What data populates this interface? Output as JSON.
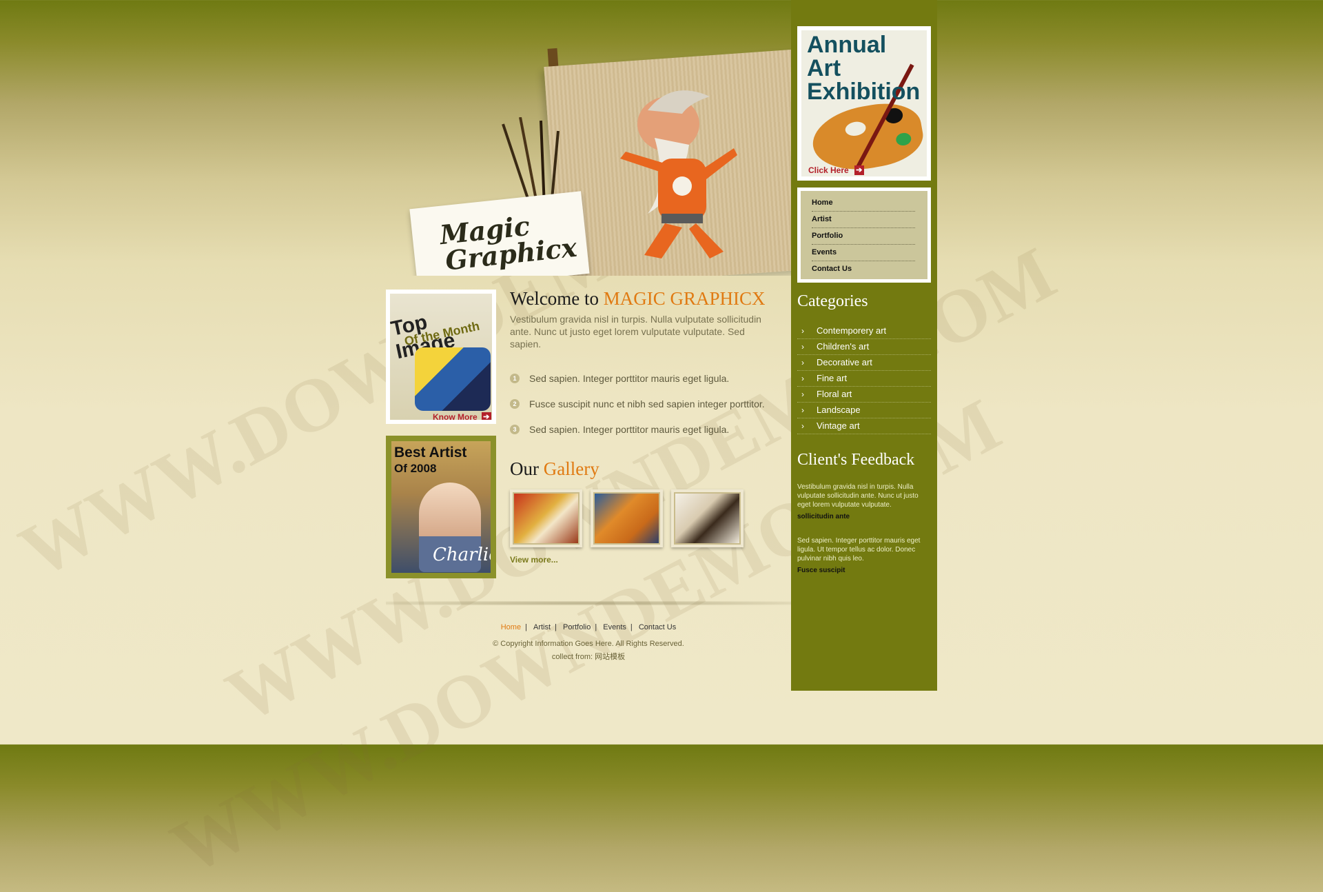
{
  "brand": {
    "logo_line1": "Magic",
    "logo_line2": "Graphicx"
  },
  "watermark": "WWW.DOWNDEMO.COM",
  "promos": {
    "top_image": {
      "title": "Top Image",
      "subtitle": "Of the Month",
      "link": "Know More"
    },
    "best_artist": {
      "title": "Best Artist",
      "subtitle": "Of 2008",
      "signature": "Charlie"
    }
  },
  "main": {
    "welcome_prefix": "Welcome to",
    "welcome_brand": "MAGIC GRAPHICX",
    "intro": "Vestibulum gravida nisl in turpis. Nulla vulputate sollicitudin ante. Nunc ut justo eget lorem vulputate vulputate. Sed sapien.",
    "list": [
      {
        "num": "1",
        "text": "Sed sapien. Integer porttitor mauris eget ligula."
      },
      {
        "num": "2",
        "text": "Fusce suscipit nunc et nibh sed sapien integer porttitor."
      },
      {
        "num": "3",
        "text": "Sed sapien. Integer porttitor mauris eget ligula."
      }
    ],
    "gallery_prefix": "Our",
    "gallery_accent": "Gallery",
    "view_more": "View more..."
  },
  "footer": {
    "nav": [
      "Home",
      "Artist",
      "Portfolio",
      "Events",
      "Contact Us"
    ],
    "copyright": "© Copyright Information Goes Here. All Rights Reserved.",
    "collect": "collect from: 网站模板"
  },
  "sidebar": {
    "exhibition": {
      "line1": "Annual",
      "line2": "Art",
      "line3": "Exhibition",
      "link": "Click Here"
    },
    "nav": [
      "Home",
      "Artist",
      "Portfolio",
      "Events",
      "Contact Us"
    ],
    "categories_title": "Categories",
    "categories": [
      "Contemporery art",
      "Children's art",
      "Decorative art",
      "Fine art",
      "Floral art",
      "Landscape",
      "Vintage art"
    ],
    "feedback_title": "Client's Feedback",
    "feedback": [
      {
        "text": "Vestibulum gravida nisl in turpis. Nulla vulputate sollicitudin ante. Nunc ut justo eget lorem vulputate vulputate.",
        "name": "sollicitudin ante"
      },
      {
        "text": "Sed sapien. Integer porttitor mauris eget ligula. Ut tempor tellus ac dolor. Donec pulvinar nibh quis leo.",
        "name": "Fusce suscipit"
      }
    ]
  },
  "colors": {
    "accent": "#e07a12",
    "sidebar": "#737a10",
    "link_red": "#b3202a"
  }
}
